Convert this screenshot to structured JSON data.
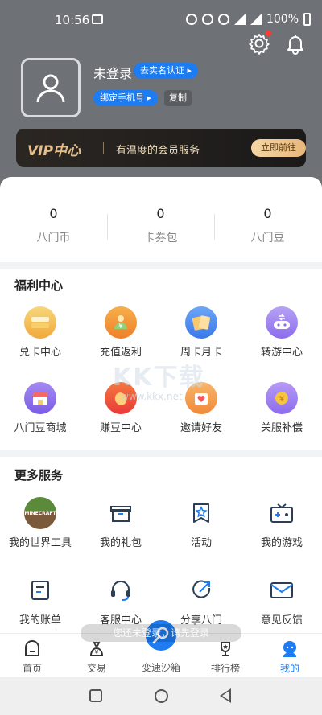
{
  "status_bar": {
    "time": "10:56",
    "battery": "100%"
  },
  "profile": {
    "username": "未登录",
    "verify_label": "去实名认证",
    "phone_label": "绑定手机号",
    "copy_label": "复制"
  },
  "vip": {
    "logo": "VIP中心",
    "tagline": "有温度的会员服务",
    "button": "立即前往"
  },
  "stats": [
    {
      "value": "0",
      "label": "八门币"
    },
    {
      "value": "0",
      "label": "卡券包"
    },
    {
      "value": "0",
      "label": "八门豆"
    }
  ],
  "welfare": {
    "title": "福利中心",
    "items": [
      {
        "label": "兑卡中心",
        "icon": "card-stack-icon",
        "color": "#f6c24f"
      },
      {
        "label": "充值返利",
        "icon": "money-bag-icon",
        "color": "#f08a2e"
      },
      {
        "label": "周卡月卡",
        "icon": "cards-icon",
        "color": "#4f8ff0"
      },
      {
        "label": "转游中心",
        "icon": "gamepad-icon",
        "color": "#9c7cf0"
      },
      {
        "label": "八门豆商城",
        "icon": "shop-icon",
        "color": "#8a6ee8"
      },
      {
        "label": "赚豆中心",
        "icon": "bean-icon",
        "color": "#f05a4a"
      },
      {
        "label": "邀请好友",
        "icon": "heart-gift-icon",
        "color": "#f3994a"
      },
      {
        "label": "关服补偿",
        "icon": "coin-icon",
        "color": "#a07cf0"
      }
    ]
  },
  "services": {
    "title": "更多服务",
    "items": [
      {
        "label": "我的世界工具",
        "icon": "minecraft-icon",
        "logo_text": "MINECRAFT"
      },
      {
        "label": "我的礼包",
        "icon": "gift-icon"
      },
      {
        "label": "活动",
        "icon": "star-flag-icon"
      },
      {
        "label": "我的游戏",
        "icon": "game-controller-icon"
      },
      {
        "label": "我的账单",
        "icon": "bill-icon"
      },
      {
        "label": "客服中心",
        "icon": "headset-icon"
      },
      {
        "label": "分享八门",
        "icon": "share-icon"
      },
      {
        "label": "意见反馈",
        "icon": "mail-icon"
      }
    ]
  },
  "toast": "您还未登录，请先登录",
  "watermark": {
    "main": "KK下载",
    "sub": "www.kkx.net"
  },
  "tabbar": {
    "tabs": [
      {
        "label": "首页",
        "icon": "home-icon"
      },
      {
        "label": "交易",
        "icon": "money-bag-tab-icon"
      },
      {
        "label": "变速沙箱",
        "icon": "search-key-icon"
      },
      {
        "label": "排行榜",
        "icon": "trophy-icon"
      },
      {
        "label": "我的",
        "icon": "profile-icon"
      }
    ],
    "active": "我的"
  },
  "colors": {
    "accent": "#1d7cf2",
    "header": "#6e7276",
    "vip_gold": "#e6c08c"
  }
}
